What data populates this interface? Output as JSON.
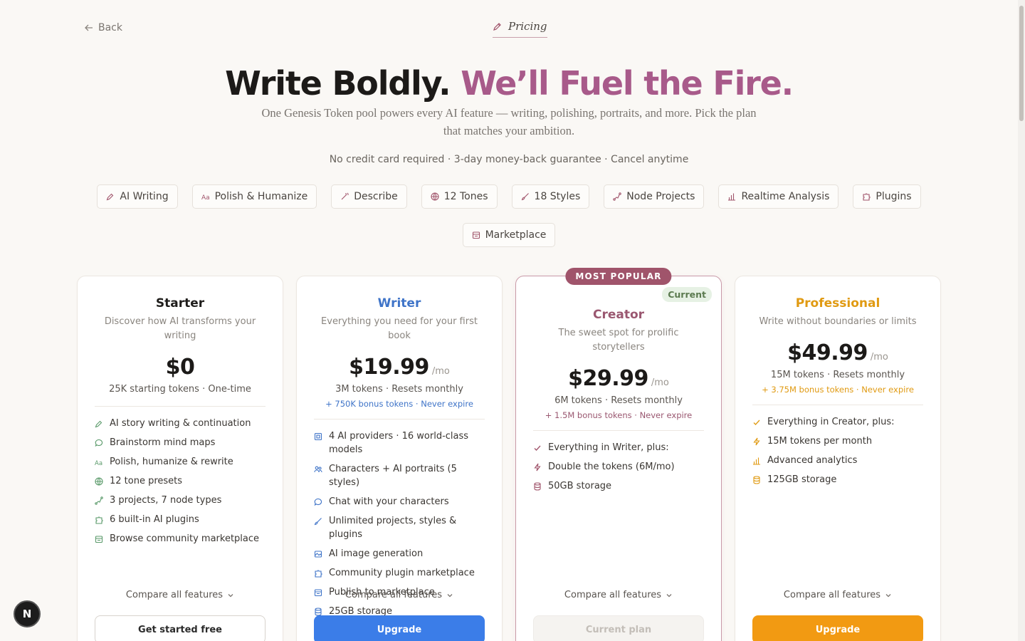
{
  "nav": {
    "back_label": "Back",
    "current_label": "Pricing"
  },
  "hero": {
    "title_lead": "Write Boldly. ",
    "title_accent": "We’ll Fuel the Fire.",
    "subtitle": "One Genesis Token pool powers every AI feature — writing, polishing, portraits, and more. Pick the plan that matches your ambition.",
    "guarantee": "No credit card required · 3-day money-back guarantee · Cancel anytime"
  },
  "chips": [
    {
      "label": "AI Writing",
      "icon": "pen-icon"
    },
    {
      "label": "Polish & Humanize",
      "icon": "text-aa-icon"
    },
    {
      "label": "Describe",
      "icon": "wand-icon"
    },
    {
      "label": "12 Tones",
      "icon": "globe-icon"
    },
    {
      "label": "18 Styles",
      "icon": "brush-icon"
    },
    {
      "label": "Node Projects",
      "icon": "nodes-icon"
    },
    {
      "label": "Realtime Analysis",
      "icon": "bar-chart-icon"
    },
    {
      "label": "Plugins",
      "icon": "puzzle-icon"
    },
    {
      "label": "Marketplace",
      "icon": "store-icon"
    }
  ],
  "plans": {
    "starter": {
      "name": "Starter",
      "desc": "Discover how AI transforms your writing",
      "price": "$0",
      "tokens": "25K starting tokens · One-time",
      "features": [
        "AI story writing & continuation",
        "Brainstorm mind maps",
        "Polish, humanize & rewrite",
        "12 tone presets",
        "3 projects, 7 node types",
        "6 built-in AI plugins",
        "Browse community marketplace"
      ],
      "compare": "Compare all features",
      "cta": "Get started free"
    },
    "writer": {
      "name": "Writer",
      "desc": "Everything you need for your first book",
      "price": "$19.99",
      "per": "/mo",
      "tokens": "3M tokens · Resets monthly",
      "bonus": "+ 750K bonus tokens · Never expire",
      "features": [
        "4 AI providers · 16 world-class models",
        "Characters + AI portraits (5 styles)",
        "Chat with your characters",
        "Unlimited projects, styles & plugins",
        "AI image generation",
        "Community plugin marketplace",
        "Publish to marketplace",
        "25GB storage"
      ],
      "compare": "Compare all features",
      "cta": "Upgrade"
    },
    "creator": {
      "badge": "MOST POPULAR",
      "current_badge": "Current",
      "name": "Creator",
      "desc": "The sweet spot for prolific storytellers",
      "price": "$29.99",
      "per": "/mo",
      "tokens": "6M tokens · Resets monthly",
      "bonus": "+ 1.5M bonus tokens · Never expire",
      "features": [
        "Everything in Writer, plus:",
        "Double the tokens (6M/mo)",
        "50GB storage"
      ],
      "compare": "Compare all features",
      "cta": "Current plan"
    },
    "professional": {
      "name": "Professional",
      "desc": "Write without boundaries or limits",
      "price": "$49.99",
      "per": "/mo",
      "tokens": "15M tokens · Resets monthly",
      "bonus": "+ 3.75M bonus tokens · Never expire",
      "features": [
        "Everything in Creator, plus:",
        "15M tokens per month",
        "Advanced analytics",
        "125GB storage"
      ],
      "compare": "Compare all features",
      "cta": "Upgrade"
    }
  },
  "fab": {
    "initial": "N"
  },
  "colors": {
    "accent_pink": "#a85a8a",
    "writer_blue": "#3b7de8",
    "creator_rose": "#a0546b",
    "pro_orange": "#f29a12",
    "background": "#faf8f5"
  }
}
